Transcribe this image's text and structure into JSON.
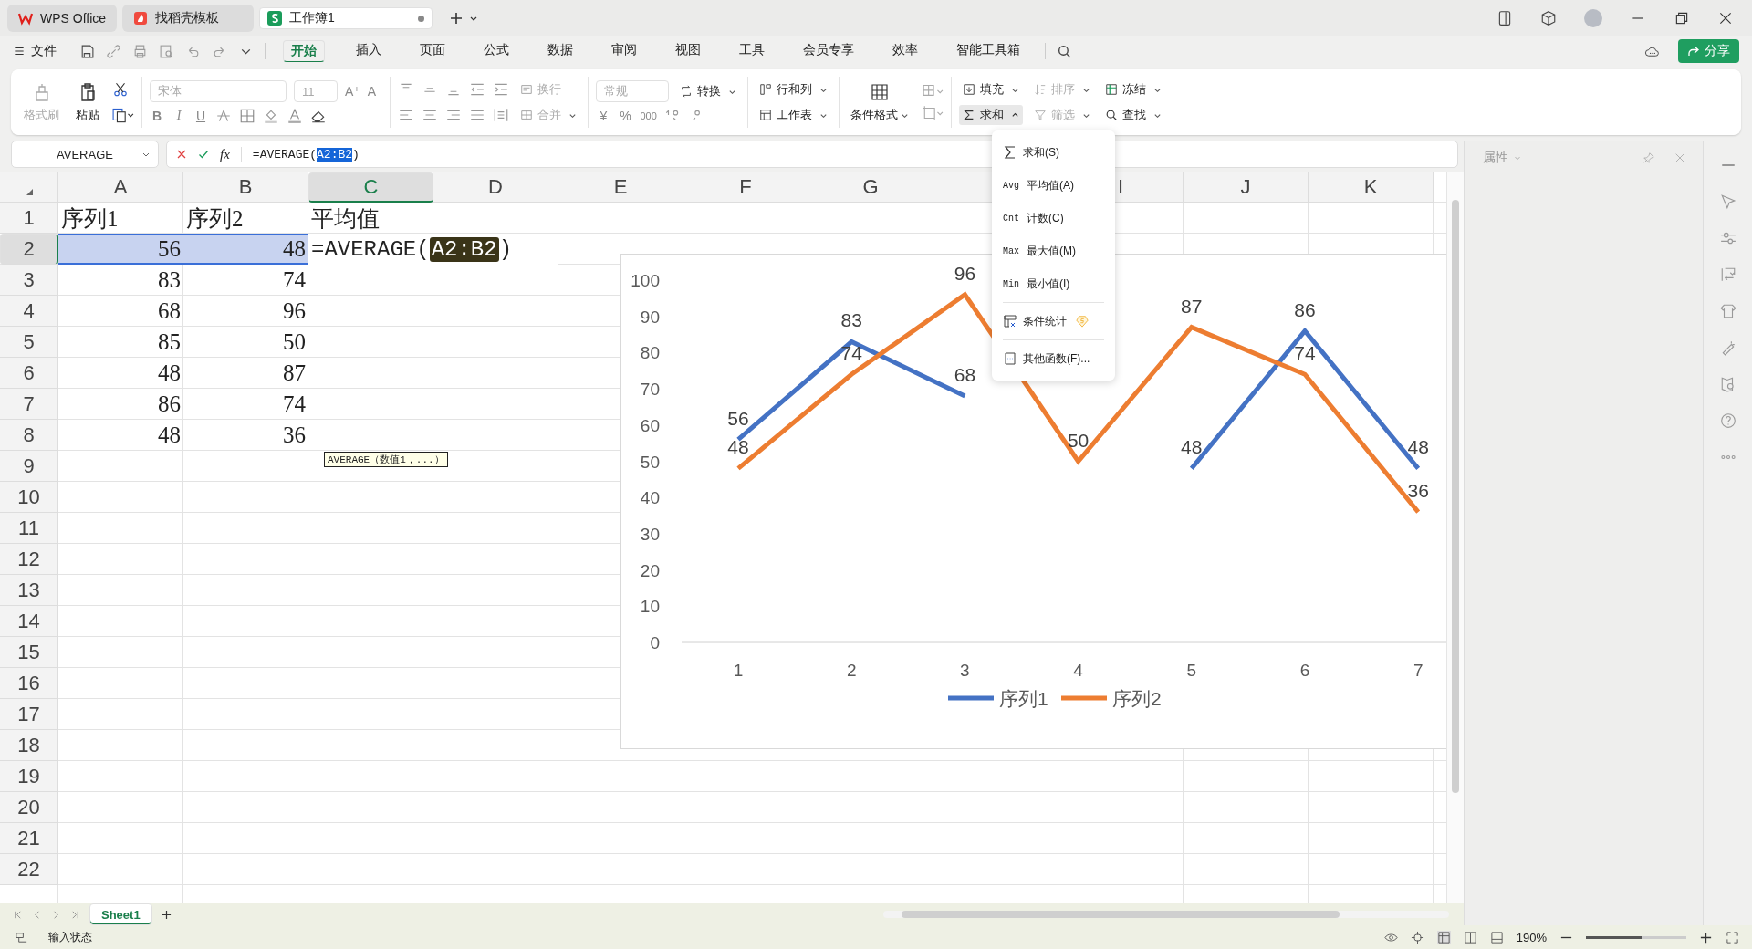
{
  "title_tabs": [
    {
      "label": "WPS Office",
      "kind": "home",
      "selected": false
    },
    {
      "label": "找稻壳模板",
      "kind": "template",
      "selected": false
    },
    {
      "label": "工作簿1",
      "kind": "sheet",
      "selected": true,
      "unsaved": true
    }
  ],
  "menu": {
    "file": "文件",
    "tabs": [
      {
        "label": "开始",
        "selected": true
      },
      {
        "label": "插入",
        "selected": false
      },
      {
        "label": "页面",
        "selected": false
      },
      {
        "label": "公式",
        "selected": false
      },
      {
        "label": "数据",
        "selected": false
      },
      {
        "label": "审阅",
        "selected": false
      },
      {
        "label": "视图",
        "selected": false
      },
      {
        "label": "工具",
        "selected": false
      },
      {
        "label": "会员专享",
        "selected": false
      },
      {
        "label": "效率",
        "selected": false
      },
      {
        "label": "智能工具箱",
        "selected": false
      }
    ],
    "share": "分享"
  },
  "ribbon": {
    "format_painter": {
      "label": "格式刷",
      "disabled": true
    },
    "paste": {
      "label": "粘贴",
      "disabled": false
    },
    "font_name": {
      "value": "宋体",
      "disabled": true
    },
    "font_size": {
      "value": "11",
      "disabled": true
    },
    "font_grow": "A⁺",
    "font_shrink": "A⁻",
    "bold": "B",
    "italic": "I",
    "underline": "U",
    "wrap": {
      "label": "换行",
      "disabled": true
    },
    "merge": {
      "label": "合并",
      "disabled": true
    },
    "number_format": {
      "value": "常规",
      "disabled": true
    },
    "currency": "¥",
    "percent": "%",
    "thousands": "000",
    "convert": "转换",
    "rows_cols": "行和列",
    "worksheet": "工作表",
    "cond_format": "条件格式",
    "fill": "填充",
    "sort": {
      "label": "排序",
      "disabled": true
    },
    "freeze": "冻结",
    "sum": {
      "label": "求和",
      "expanded": true
    },
    "filter": {
      "label": "筛选",
      "disabled": true
    },
    "find": "查找"
  },
  "formula_bar": {
    "name_box": "AVERAGE",
    "fx": "fx",
    "formula_prefix": "=AVERAGE(",
    "formula_ref": "A2:B2",
    "formula_suffix": ")"
  },
  "grid": {
    "columns": [
      {
        "label": "A",
        "selected": false
      },
      {
        "label": "B",
        "selected": false
      },
      {
        "label": "C",
        "selected": true
      },
      {
        "label": "D",
        "selected": false
      },
      {
        "label": "E",
        "selected": false
      },
      {
        "label": "F",
        "selected": false
      },
      {
        "label": "G",
        "selected": false
      },
      {
        "selected": false
      },
      {
        "label": "I",
        "selected": false
      },
      {
        "label": "J",
        "selected": false
      },
      {
        "label": "K",
        "selected": false
      }
    ],
    "rows": [
      {
        "number": "1",
        "selected": false,
        "cells": [
          {
            "kind": "text",
            "text": "序列1",
            "selected": false
          },
          {
            "kind": "text",
            "text": "序列2",
            "selected": false
          },
          {
            "kind": "text",
            "text": "平均值",
            "selected": false
          }
        ]
      },
      {
        "number": "2",
        "selected": true,
        "cells": [
          {
            "kind": "number",
            "text": "56",
            "selected": true
          },
          {
            "kind": "number",
            "text": "48",
            "selected": true
          },
          {
            "kind": "formula",
            "prefix": "=AVERAGE(",
            "ref": "A2:B2",
            "suffix": ")",
            "selected": false
          }
        ]
      },
      {
        "number": "3",
        "selected": false,
        "cells": [
          {
            "kind": "number",
            "text": "83",
            "selected": false
          },
          {
            "kind": "number",
            "text": "74",
            "selected": false
          }
        ]
      },
      {
        "number": "4",
        "selected": false,
        "cells": [
          {
            "kind": "number",
            "text": "68",
            "selected": false
          },
          {
            "kind": "number",
            "text": "96",
            "selected": false
          }
        ]
      },
      {
        "number": "5",
        "selected": false,
        "cells": [
          {
            "kind": "number",
            "text": "85",
            "selected": false
          },
          {
            "kind": "number",
            "text": "50",
            "selected": false
          }
        ]
      },
      {
        "number": "6",
        "selected": false,
        "cells": [
          {
            "kind": "number",
            "text": "48",
            "selected": false
          },
          {
            "kind": "number",
            "text": "87",
            "selected": false
          }
        ]
      },
      {
        "number": "7",
        "selected": false,
        "cells": [
          {
            "kind": "number",
            "text": "86",
            "selected": false
          },
          {
            "kind": "number",
            "text": "74",
            "selected": false
          }
        ]
      },
      {
        "number": "8",
        "selected": false,
        "cells": [
          {
            "kind": "number",
            "text": "48",
            "selected": false
          },
          {
            "kind": "number",
            "text": "36",
            "selected": false
          }
        ]
      },
      {
        "number": "9",
        "selected": false,
        "cells": []
      },
      {
        "number": "10",
        "selected": false,
        "cells": []
      },
      {
        "number": "11",
        "selected": false,
        "cells": []
      },
      {
        "number": "12",
        "selected": false,
        "cells": []
      },
      {
        "number": "13",
        "selected": false,
        "cells": []
      },
      {
        "number": "14",
        "selected": false,
        "cells": []
      },
      {
        "number": "15",
        "selected": false,
        "cells": []
      },
      {
        "number": "16",
        "selected": false,
        "cells": []
      },
      {
        "number": "17",
        "selected": false,
        "cells": []
      },
      {
        "number": "18",
        "selected": false,
        "cells": []
      },
      {
        "number": "19",
        "selected": false,
        "cells": []
      },
      {
        "number": "20",
        "selected": false,
        "cells": []
      },
      {
        "number": "21",
        "selected": false,
        "cells": []
      },
      {
        "number": "22",
        "selected": false,
        "cells": []
      }
    ],
    "tooltip": "AVERAGE（数值1，...）"
  },
  "chart": {
    "chart_data": {
      "type": "line",
      "categories": [
        "1",
        "2",
        "3",
        "4",
        "5",
        "6",
        "7"
      ],
      "series": [
        {
          "name": "序列1",
          "color": "#4472c4",
          "values": [
            56,
            83,
            68,
            null,
            48,
            86,
            48
          ]
        },
        {
          "name": "序列2",
          "color": "#ed7d31",
          "values": [
            48,
            74,
            96,
            50,
            87,
            74,
            36
          ]
        }
      ],
      "ylim": [
        0,
        100
      ],
      "yticks": [
        0,
        10,
        20,
        30,
        40,
        50,
        60,
        70,
        80,
        90,
        100
      ],
      "data_labels": true,
      "legend": "bottom"
    }
  },
  "sum_menu": [
    {
      "kind": "sigma",
      "label": "求和(S)"
    },
    {
      "kind": "abbr",
      "abbr": "Avg",
      "label": "平均值(A)"
    },
    {
      "kind": "abbr",
      "abbr": "Cnt",
      "label": "计数(C)"
    },
    {
      "kind": "abbr",
      "abbr": "Max",
      "label": "最大值(M)"
    },
    {
      "kind": "abbr",
      "abbr": "Min",
      "label": "最小值(I)"
    },
    {
      "kind": "table",
      "label": "条件统计",
      "premium": true,
      "divider": true
    },
    {
      "kind": "doc",
      "label": "其他函数(F)...",
      "divider": true
    }
  ],
  "properties_panel": {
    "title": "属性"
  },
  "sheet_tabs": [
    {
      "label": "Sheet1",
      "selected": true
    }
  ],
  "status_bar": {
    "mode": "输入状态",
    "zoom": "190%",
    "zoom_slider": {
      "level": 0.55
    }
  }
}
